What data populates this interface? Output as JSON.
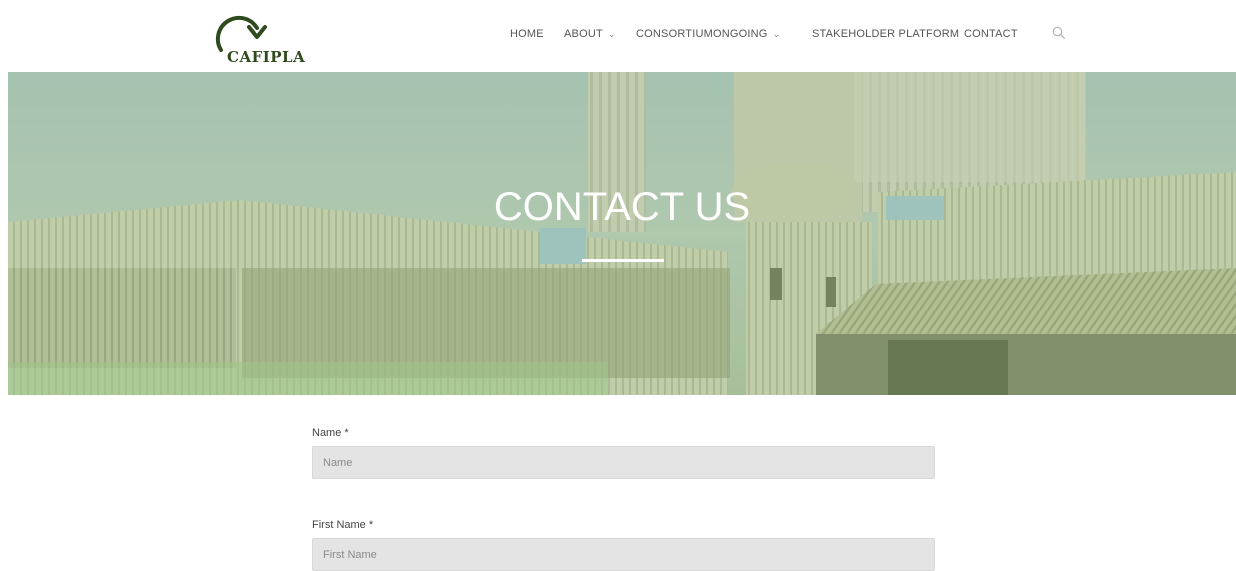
{
  "logo": {
    "text": "CAFIPLA"
  },
  "nav": {
    "items": [
      {
        "label": "HOME",
        "dropdown": false
      },
      {
        "label": "ABOUT",
        "dropdown": true
      },
      {
        "label": "CONSORTIUM",
        "dropdown": false
      },
      {
        "label": "ONGOING",
        "dropdown": true
      },
      {
        "label": "STAKEHOLDER PLATFORM",
        "dropdown": false
      },
      {
        "label": "CONTACT",
        "dropdown": false
      }
    ],
    "caret": "⌄"
  },
  "hero": {
    "title": "CONTACT US"
  },
  "form": {
    "name_label": "Name *",
    "name_placeholder": "Name",
    "first_name_label": "First Name *",
    "first_name_placeholder": "First Name"
  },
  "colors": {
    "brand": "#2f4a1f",
    "hero_overlay": "#9cc08a",
    "input_bg": "#e4e4e4"
  },
  "icons": {
    "logo": "recycle-arrow-icon",
    "search": "search-icon"
  }
}
